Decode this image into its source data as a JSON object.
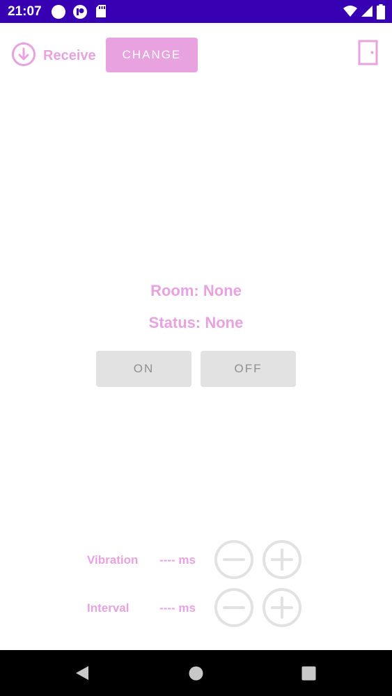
{
  "status_bar": {
    "time": "21:07",
    "color": "#3700b3",
    "left_icons": [
      "circle-notification-icon",
      "app-notification-icon",
      "sd-card-icon"
    ],
    "right_icons": [
      "wifi-icon",
      "cellular-signal-icon",
      "battery-icon"
    ]
  },
  "app_bar": {
    "receive_label": "Receive",
    "receive_icon": "download-circle-icon",
    "change_label": "CHANGE",
    "exit_icon": "door-exit-icon",
    "accent_color": "#e8a2e0"
  },
  "main": {
    "room_text": "Room: None",
    "status_text": "Status: None",
    "on_label": "ON",
    "off_label": "OFF"
  },
  "controls": {
    "vibration": {
      "label": "Vibration",
      "value": "---- ms"
    },
    "interval": {
      "label": "Interval",
      "value": "---- ms"
    }
  },
  "nav_bar": {
    "icons": [
      "back-icon",
      "home-icon",
      "recents-icon"
    ]
  }
}
